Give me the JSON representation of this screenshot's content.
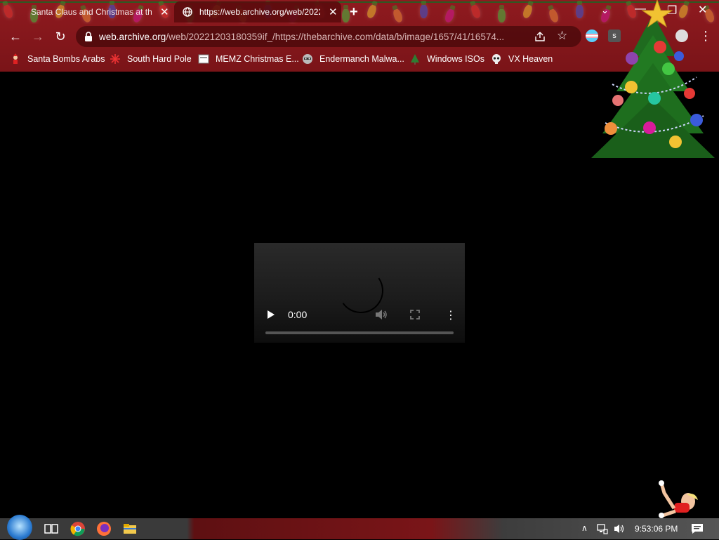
{
  "tabs": [
    {
      "title": "Santa Claus and Christmas at the",
      "active": false
    },
    {
      "title": "https://web.archive.org/web/2022",
      "active": true
    }
  ],
  "window_controls": [
    "minimize",
    "restore",
    "close"
  ],
  "address_bar": {
    "host": "web.archive.org",
    "path": "/web/20221203180359if_/https://thebarchive.com/data/b/image/1657/41/16574..."
  },
  "bookmarks": [
    {
      "label": "Santa Bombs Arabs",
      "icon": "santa-icon"
    },
    {
      "label": "South Hard Pole",
      "icon": "snowflake-icon"
    },
    {
      "label": "MEMZ Christmas E...",
      "icon": "page-icon"
    },
    {
      "label": "Endermanch Malwa...",
      "icon": "raccoon-icon"
    },
    {
      "label": "Windows ISOs",
      "icon": "tree-icon"
    },
    {
      "label": "VX Heaven",
      "icon": "skull-icon"
    }
  ],
  "video": {
    "time": "0:00",
    "progress": 0,
    "state": "loading"
  },
  "taskbar": {
    "apps": [
      "task-view-icon",
      "chrome-icon",
      "firefox-icon",
      "file-explorer-icon"
    ],
    "clock": "9:53:06 PM"
  },
  "colors": {
    "chrome_bg": "#8f1a1f",
    "active_tab": "#5a0a0c",
    "page_bg": "#000000"
  }
}
